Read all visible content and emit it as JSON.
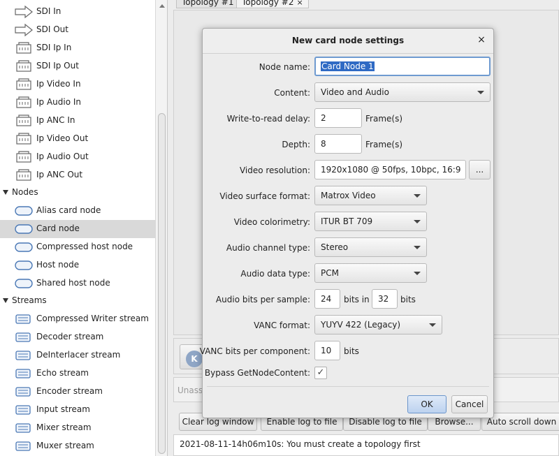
{
  "tree": {
    "items_top": [
      {
        "label": "SDI In",
        "icon": "sdi-in-icon"
      },
      {
        "label": "SDI Out",
        "icon": "sdi-out-icon"
      },
      {
        "label": "SDI Ip In",
        "icon": "sdi-ip-in-icon"
      },
      {
        "label": "SDI Ip Out",
        "icon": "sdi-ip-out-icon"
      },
      {
        "label": "Ip Video In",
        "icon": "ip-video-in-icon"
      },
      {
        "label": "Ip Audio In",
        "icon": "ip-audio-in-icon"
      },
      {
        "label": "Ip ANC In",
        "icon": "ip-anc-in-icon"
      },
      {
        "label": "Ip Video Out",
        "icon": "ip-video-out-icon"
      },
      {
        "label": "Ip Audio Out",
        "icon": "ip-audio-out-icon"
      },
      {
        "label": "Ip ANC Out",
        "icon": "ip-anc-out-icon"
      }
    ],
    "nodes_category": "Nodes",
    "nodes": [
      {
        "label": "Alias card node",
        "icon": "alias-card-node-icon"
      },
      {
        "label": "Card node",
        "icon": "card-node-icon",
        "selected": true
      },
      {
        "label": "Compressed host node",
        "icon": "compressed-host-node-icon"
      },
      {
        "label": "Host node",
        "icon": "host-node-icon"
      },
      {
        "label": "Shared host node",
        "icon": "shared-host-node-icon"
      }
    ],
    "streams_category": "Streams",
    "streams": [
      {
        "label": "Compressed Writer stream",
        "icon": "compressed-writer-stream-icon"
      },
      {
        "label": "Decoder stream",
        "icon": "decoder-stream-icon"
      },
      {
        "label": "DeInterlacer stream",
        "icon": "deinterlacer-stream-icon"
      },
      {
        "label": "Echo stream",
        "icon": "echo-stream-icon"
      },
      {
        "label": "Encoder stream",
        "icon": "encoder-stream-icon"
      },
      {
        "label": "Input stream",
        "icon": "input-stream-icon"
      },
      {
        "label": "Mixer stream",
        "icon": "mixer-stream-icon"
      },
      {
        "label": "Muxer stream",
        "icon": "muxer-stream-icon"
      }
    ]
  },
  "tabs": [
    {
      "label": "Topology #1"
    },
    {
      "label": "Topology #2",
      "close": "×"
    }
  ],
  "status": {
    "unassigned": "Unass"
  },
  "buttons": {
    "clear_log": "Clear log window",
    "enable_log": "Enable log to file",
    "disable_log": "Disable log to file",
    "browse": "Browse...",
    "auto_scroll": "Auto scroll down"
  },
  "log": {
    "line": "2021-08-11-14h06m10s: You must create a topology first"
  },
  "dialog": {
    "title": "New card node settings",
    "close": "×",
    "node_name_label": "Node name:",
    "node_name_value": "Card Node 1",
    "content_label": "Content:",
    "content_value": "Video and Audio",
    "write_read_label": "Write-to-read delay:",
    "write_read_value": "2",
    "write_read_unit": "Frame(s)",
    "depth_label": "Depth:",
    "depth_value": "8",
    "depth_unit": "Frame(s)",
    "video_res_label": "Video resolution:",
    "video_res_value": "1920x1080 @ 50fps, 10bpc, 16:9",
    "video_res_button": "...",
    "surface_label": "Video surface format:",
    "surface_value": "Matrox Video",
    "colorimetry_label": "Video colorimetry:",
    "colorimetry_value": "ITUR BT 709",
    "audio_channel_label": "Audio channel type:",
    "audio_channel_value": "Stereo",
    "audio_data_label": "Audio data type:",
    "audio_data_value": "PCM",
    "audio_bits_label": "Audio bits per sample:",
    "audio_bits_value": "24",
    "audio_bits_in": "bits in",
    "audio_bits_container": "32",
    "audio_bits_unit": "bits",
    "vanc_format_label": "VANC format:",
    "vanc_format_value": "YUYV 422 (Legacy)",
    "vanc_bits_label": "VANC bits per component:",
    "vanc_bits_value": "10",
    "vanc_bits_unit": "bits",
    "bypass_label": "Bypass GetNodeContent:",
    "bypass_checked": "✓",
    "ok": "OK",
    "cancel": "Cancel"
  }
}
